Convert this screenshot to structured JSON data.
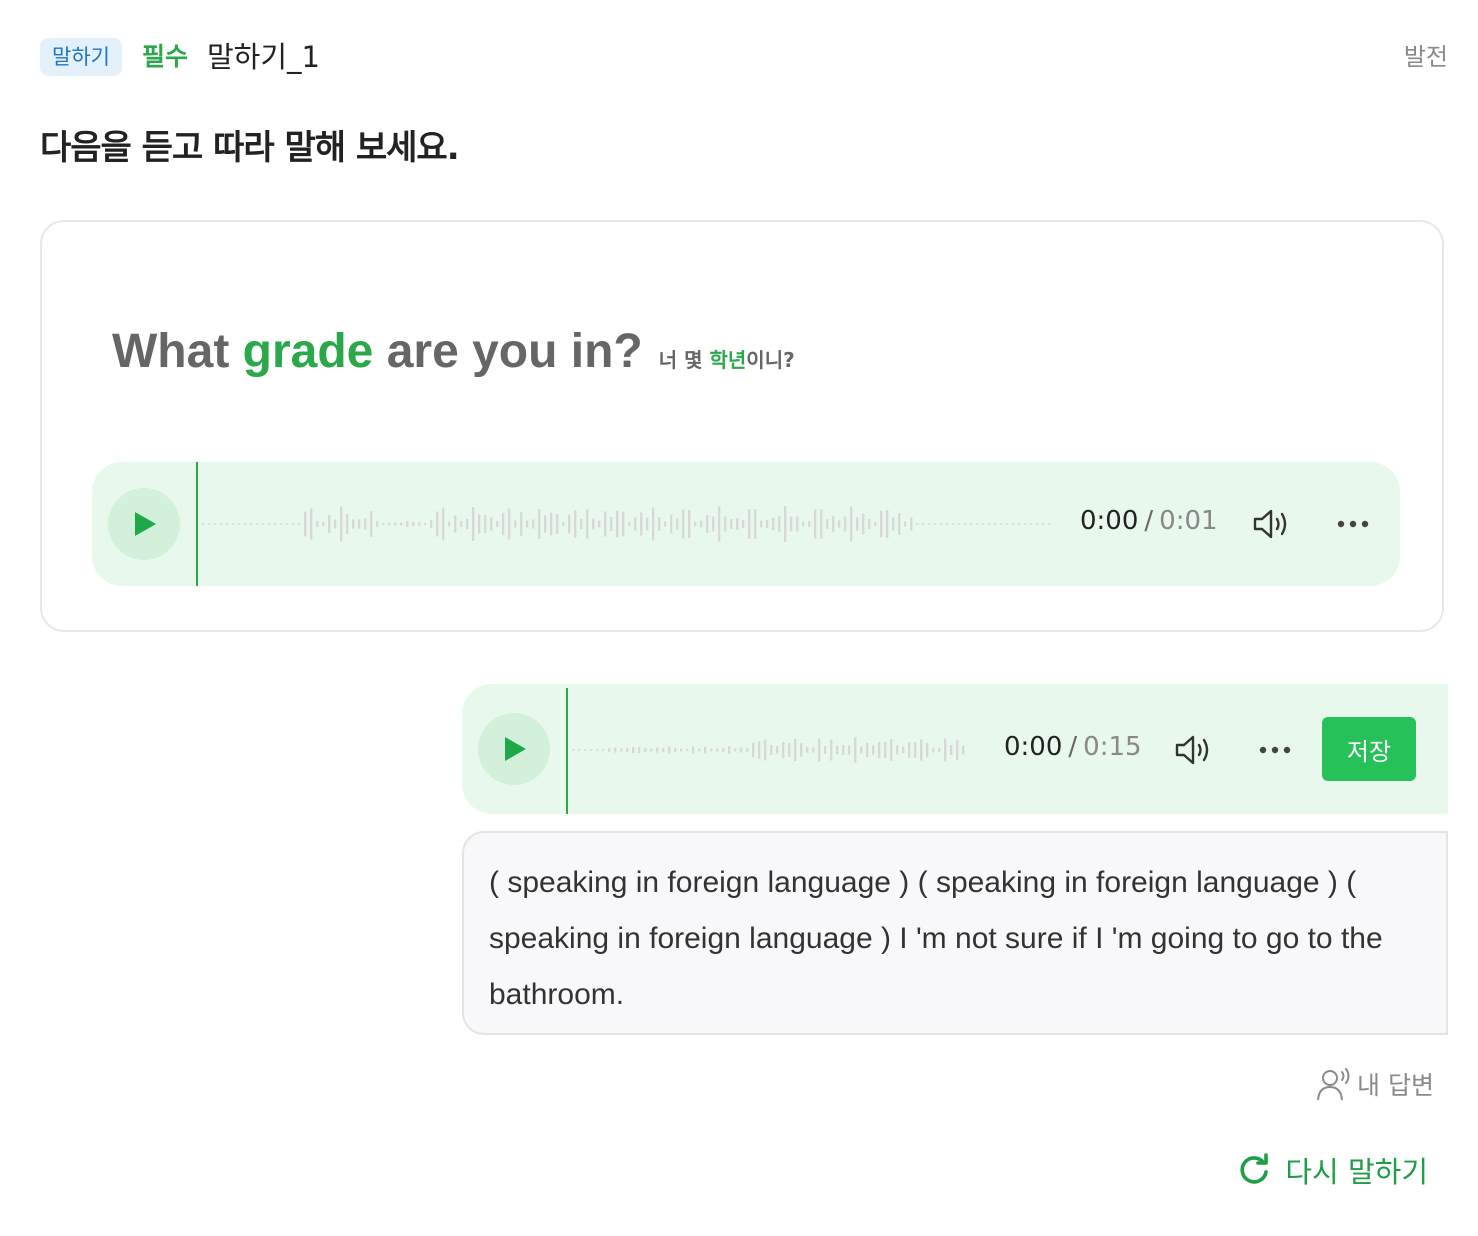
{
  "header": {
    "badge": "말하기",
    "required": "필수",
    "question_name": "말하기_1",
    "level": "발전"
  },
  "instruction": "다음을 듣고 따라 말해 보세요.",
  "question": {
    "sentence_before": "What ",
    "sentence_highlight": "grade",
    "sentence_after": " are you in?",
    "translation_before": "너 몇 ",
    "translation_highlight": "학년",
    "translation_after": "이니?",
    "player": {
      "current": "0:00",
      "separator": "/",
      "duration": "0:01"
    }
  },
  "answer": {
    "player": {
      "current": "0:00",
      "separator": "/",
      "duration": "0:15"
    },
    "save_label": "저장",
    "transcript": "( speaking in foreign language )  ( speaking in foreign language )  ( speaking in foreign language )  I 'm not sure if I 'm going to go to the bathroom."
  },
  "my_answer_label": "내 답변",
  "retry_label": "다시 말하기",
  "colors": {
    "accent_green": "#2aa84a",
    "button_green": "#27c159",
    "player_bg": "#e8f8ec",
    "badge_bg": "#e4f1fb",
    "badge_text": "#1f74c8"
  }
}
